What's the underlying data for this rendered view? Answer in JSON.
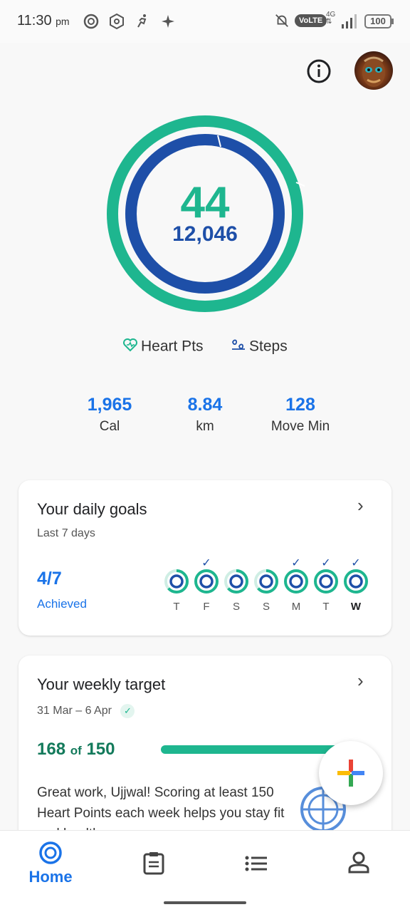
{
  "status_bar": {
    "time": "11:30",
    "ampm": "pm",
    "network_type": "VoLTE",
    "data_type": "4G",
    "battery": "100"
  },
  "header": {
    "info_icon": "info-icon",
    "avatar": "avatar"
  },
  "rings": {
    "heart_points": "44",
    "steps": "12,046",
    "heart_points_goal_progress": 1.0,
    "steps_goal_progress": 1.0,
    "color_heart": "#1eb68f",
    "color_steps": "#1e4fa8"
  },
  "legend": {
    "heart_pts_label": "Heart Pts",
    "steps_label": "Steps"
  },
  "metrics": [
    {
      "value": "1,965",
      "label": "Cal"
    },
    {
      "value": "8.84",
      "label": "km"
    },
    {
      "value": "128",
      "label": "Move Min"
    }
  ],
  "daily_goals": {
    "title": "Your daily goals",
    "subtitle": "Last 7 days",
    "achieved_count": "4/7",
    "achieved_label": "Achieved",
    "days": [
      {
        "label": "T",
        "achieved": false,
        "today": false
      },
      {
        "label": "F",
        "achieved": true,
        "today": false
      },
      {
        "label": "S",
        "achieved": false,
        "today": false
      },
      {
        "label": "S",
        "achieved": false,
        "today": false
      },
      {
        "label": "M",
        "achieved": true,
        "today": false
      },
      {
        "label": "T",
        "achieved": true,
        "today": false
      },
      {
        "label": "W",
        "achieved": true,
        "today": true
      }
    ]
  },
  "weekly_target": {
    "title": "Your weekly target",
    "date_range": "31 Mar – 6 Apr",
    "value": "168",
    "of_label": "of",
    "target": "150",
    "progress": 1.0,
    "message": "Great work, Ujjwal! Scoring at least 150 Heart Points each week helps you stay fit and healthy."
  },
  "bottom_nav": {
    "home_label": "Home",
    "items": [
      "home-icon",
      "journal-icon",
      "browse-icon",
      "profile-icon"
    ]
  },
  "colors": {
    "accent_blue": "#1a73e8",
    "teal": "#1eb68f",
    "navy": "#1e4fa8"
  }
}
